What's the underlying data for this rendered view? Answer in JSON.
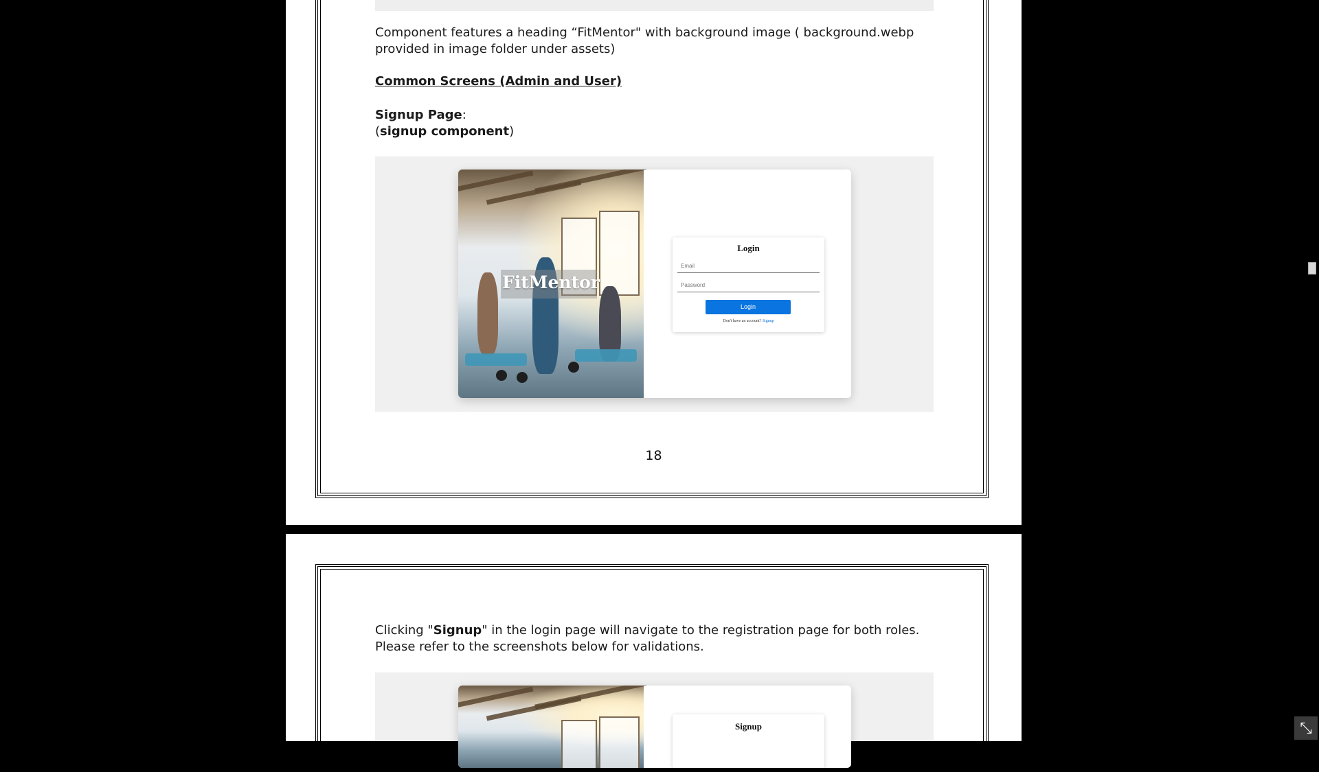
{
  "page1": {
    "intro_text": "Component features a heading “FitMentor\" with background image ( background.webp provided in image folder under assets)",
    "section_heading": "Common Screens (Admin and User)",
    "signup_label_bold": "Signup Page",
    "signup_label_colon": ":",
    "component_open": "(",
    "component_name": "signup component",
    "component_close": ")",
    "screenshot": {
      "brand_heading": "FitMentor",
      "login_title": "Login",
      "email_placeholder": "Email",
      "password_placeholder": "Password",
      "login_button": "Login",
      "no_account_text": "Don't have an account?",
      "signup_link": "Signup"
    },
    "page_number": "18"
  },
  "page2": {
    "text_prefix": "Clicking \"",
    "text_bold": "Signup",
    "text_suffix": "\" in the login page will navigate to the registration page for both roles. Please refer to the screenshots below for validations.",
    "screenshot": {
      "form_title": "Signup"
    }
  },
  "viewer": {
    "exit_fullscreen_icon": "exit-fullscreen-icon"
  }
}
